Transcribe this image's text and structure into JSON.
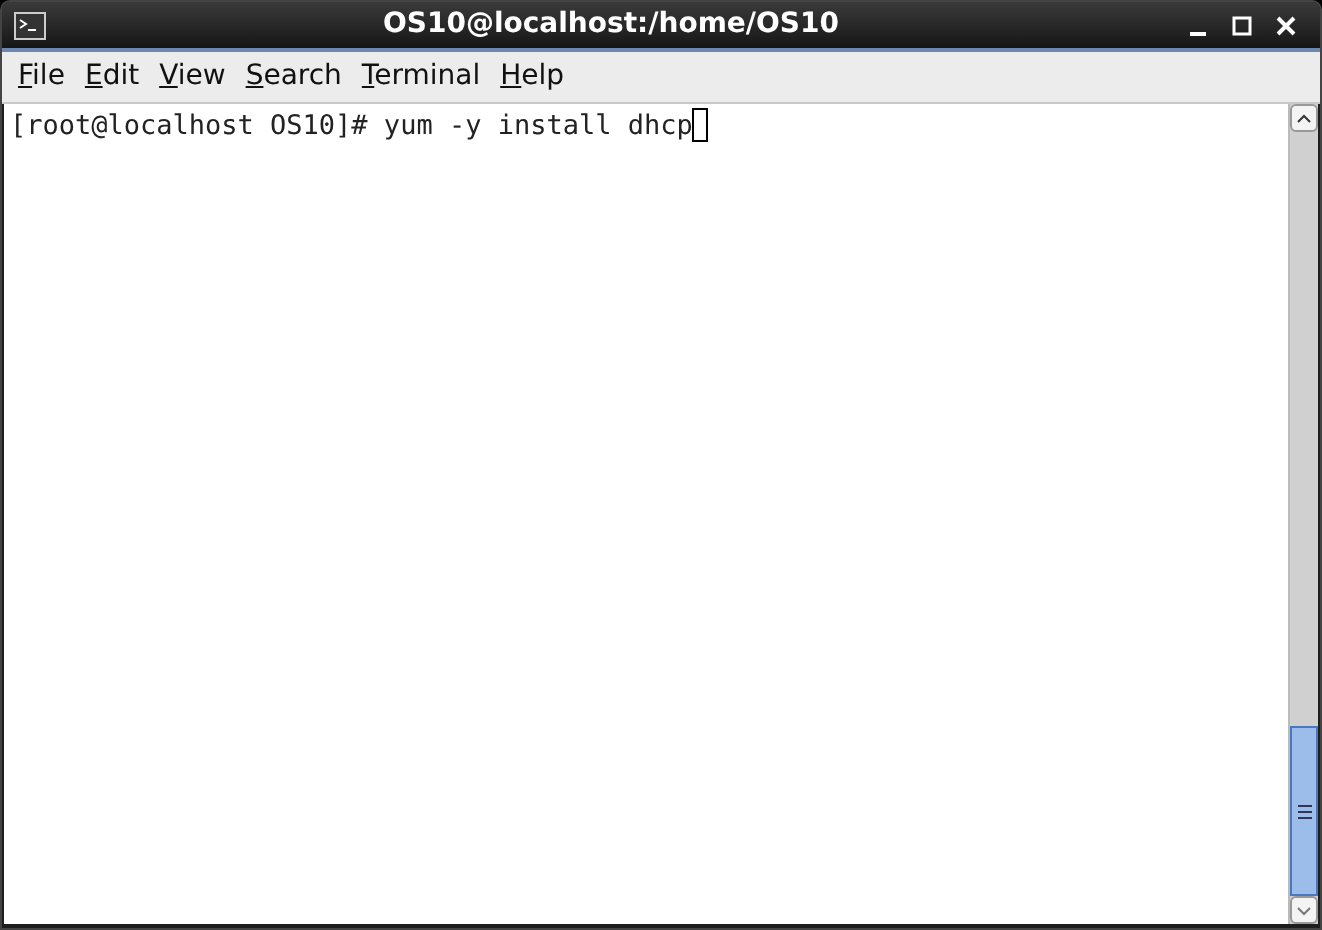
{
  "window": {
    "title": "OS10@localhost:/home/OS10"
  },
  "menu": [
    {
      "label": "File"
    },
    {
      "label": "Edit"
    },
    {
      "label": "View"
    },
    {
      "label": "Search"
    },
    {
      "label": "Terminal"
    },
    {
      "label": "Help"
    }
  ],
  "terminal": {
    "lines": [
      "[root@localhost OS10]# yum -y install dhcp"
    ]
  }
}
